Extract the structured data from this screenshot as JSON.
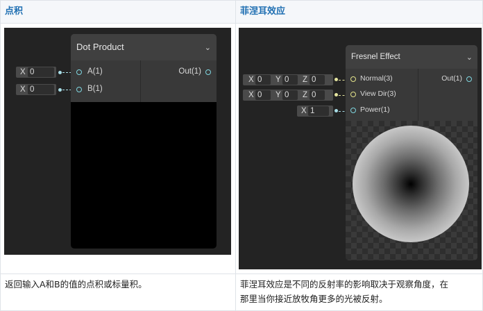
{
  "columns": [
    {
      "heading": "点积",
      "description": "返回输入A和B的值的点积或标量积。",
      "node": {
        "title": "Dot Product",
        "inputs": [
          {
            "label": "A(1)",
            "fields": [
              {
                "axis": "X",
                "value": "0"
              }
            ]
          },
          {
            "label": "B(1)",
            "fields": [
              {
                "axis": "X",
                "value": "0"
              }
            ]
          }
        ],
        "output": "Out(1)"
      }
    },
    {
      "heading": "菲涅耳效应",
      "description_lines": [
        "菲涅耳效应是不同的反射率的影响取决于观察角度，在",
        "那里当你接近放牧角更多的光被反射。"
      ],
      "node": {
        "title": "Fresnel Effect",
        "inputs": [
          {
            "label": "Normal(3)",
            "fields": [
              {
                "axis": "X",
                "value": "0"
              },
              {
                "axis": "Y",
                "value": "0"
              },
              {
                "axis": "Z",
                "value": "0"
              }
            ]
          },
          {
            "label": "View Dir(3)",
            "fields": [
              {
                "axis": "X",
                "value": "0"
              },
              {
                "axis": "Y",
                "value": "0"
              },
              {
                "axis": "Z",
                "value": "0"
              }
            ]
          },
          {
            "label": "Power(1)",
            "fields": [
              {
                "axis": "X",
                "value": "1"
              }
            ]
          }
        ],
        "output": "Out(1)"
      }
    }
  ],
  "icons": {
    "dropdown": "chevron-down-icon"
  },
  "colors": {
    "heading": "#1f6fb2",
    "vector_port": "#7fd6e0",
    "vector3_port": "#e3e38a"
  }
}
